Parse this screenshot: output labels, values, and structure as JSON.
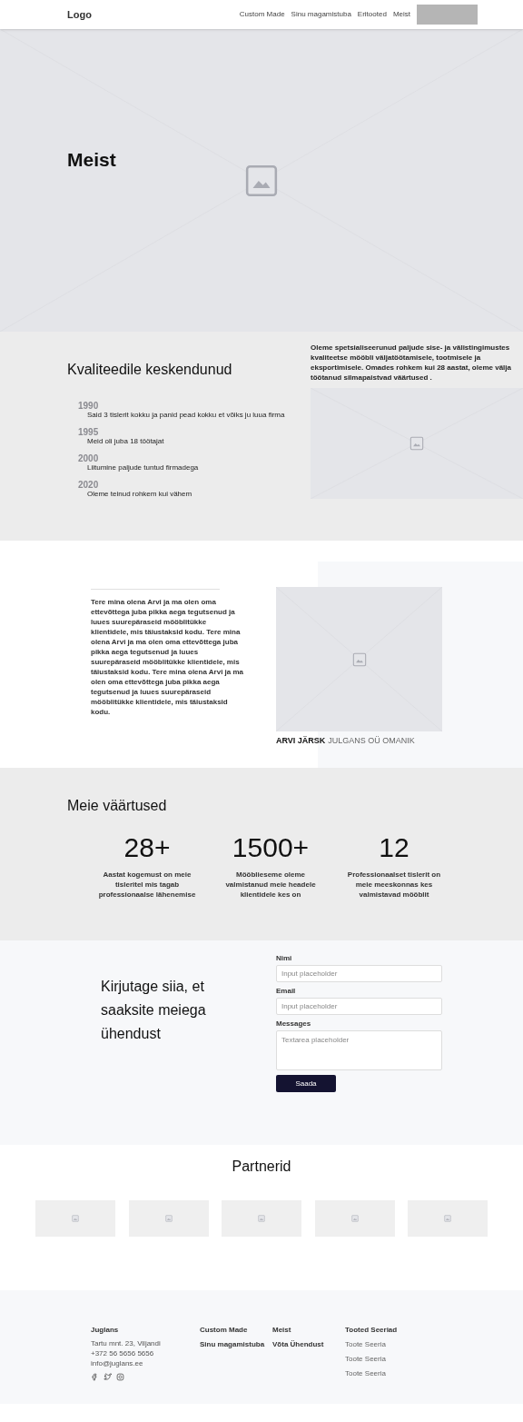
{
  "nav": {
    "logo": "Logo",
    "links": [
      "Custom Made",
      "Sinu magamistuba",
      "Eritooted",
      "Meist"
    ]
  },
  "hero": {
    "title": "Meist"
  },
  "quality": {
    "title": "Kvaliteedile keskendunud",
    "intro": "Oleme spetsialiseerunud paljude sise- ja välistingimustes kvaliteetse mööbli väljatöötamisele, tootmisele ja eksportimisele. Omades rohkem kui 28 aastat, oleme välja töötanud silmapaistvad väärtused .",
    "timeline": [
      {
        "year": "1990",
        "text": "Said 3 tislerit kokku ja panid pead kokku et võiks ju luua firma"
      },
      {
        "year": "1995",
        "text": "Meid oli juba 18 töötajat"
      },
      {
        "year": "2000",
        "text": "Liitumine paljude tuntud firmadega"
      },
      {
        "year": "2020",
        "text": "Oleme teinud rohkem kui vähem"
      }
    ]
  },
  "owner": {
    "bio": "Tere mina olena Arvi ja ma olen oma ettevõttega juba pikka  aega tegutsenud  ja luues suurepäraseid mööblitükke klientidele, mis täiustaksid kodu. Tere mina olena Arvi ja ma olen oma ettevõttega juba pikka  aega tegutsenud  ja  luues suurepäraseid mööblitükke klientidele, mis täiustaksid kodu. Tere mina olena Arvi ja ma olen oma ettevõttega juba pikka  aega tegutsenud  ja luues suurepäraseid mööblitükke klientidele, mis täiustaksid kodu.",
    "name": "ARVI JÄRSK",
    "role": "JULGANS OÜ OMANIK"
  },
  "values": {
    "title": "Meie väärtused",
    "stats": [
      {
        "number": "28+",
        "text": "Aastat kogemust on meie tisleritel mis tagab professionaalse lähenemise"
      },
      {
        "number": "1500+",
        "text": "Mööblieseme oleme valmistanud meie headele klientidele kes on"
      },
      {
        "number": "12",
        "text": "Professionaalset tislerit on meie meeskonnas kes valmistavad mööblit"
      }
    ]
  },
  "contact": {
    "title": "Kirjutage siia, et saaksite meiega ühendust",
    "fields": [
      {
        "label": "Nimi",
        "placeholder": "Input placeholder",
        "kind": "input"
      },
      {
        "label": "Email",
        "placeholder": "Input placeholder",
        "kind": "input"
      },
      {
        "label": "Messages",
        "placeholder": "Textarea placeholder",
        "kind": "textarea"
      }
    ],
    "button": "Saada"
  },
  "partners": {
    "title": "Partnerid",
    "logos": [
      {
        "kind": "placeholder"
      },
      {
        "kind": "placeholder"
      },
      {
        "kind": "placeholder"
      },
      {
        "kind": "placeholder"
      },
      {
        "kind": "placeholder"
      }
    ]
  },
  "footer": {
    "brand": "Juglans",
    "address": "Tartu mnt. 23, Viljandi",
    "phone": "+372 56 5656 5656",
    "email": "info@juglans.ee",
    "columns": [
      {
        "items": [
          {
            "text": "Custom Made",
            "bold": true
          },
          {
            "text": "Sinu magamistuba",
            "bold": true
          }
        ]
      },
      {
        "items": [
          {
            "text": "Meist",
            "bold": true
          },
          {
            "text": "Võta Ühendust",
            "bold": true
          }
        ]
      },
      {
        "items": [
          {
            "text": "Tooted Seeriad",
            "bold": true
          },
          {
            "text": "Toote Seeria",
            "bold": false
          },
          {
            "text": "Toote Seeria",
            "bold": false
          },
          {
            "text": "Toote Seeria",
            "bold": false
          }
        ]
      }
    ]
  }
}
